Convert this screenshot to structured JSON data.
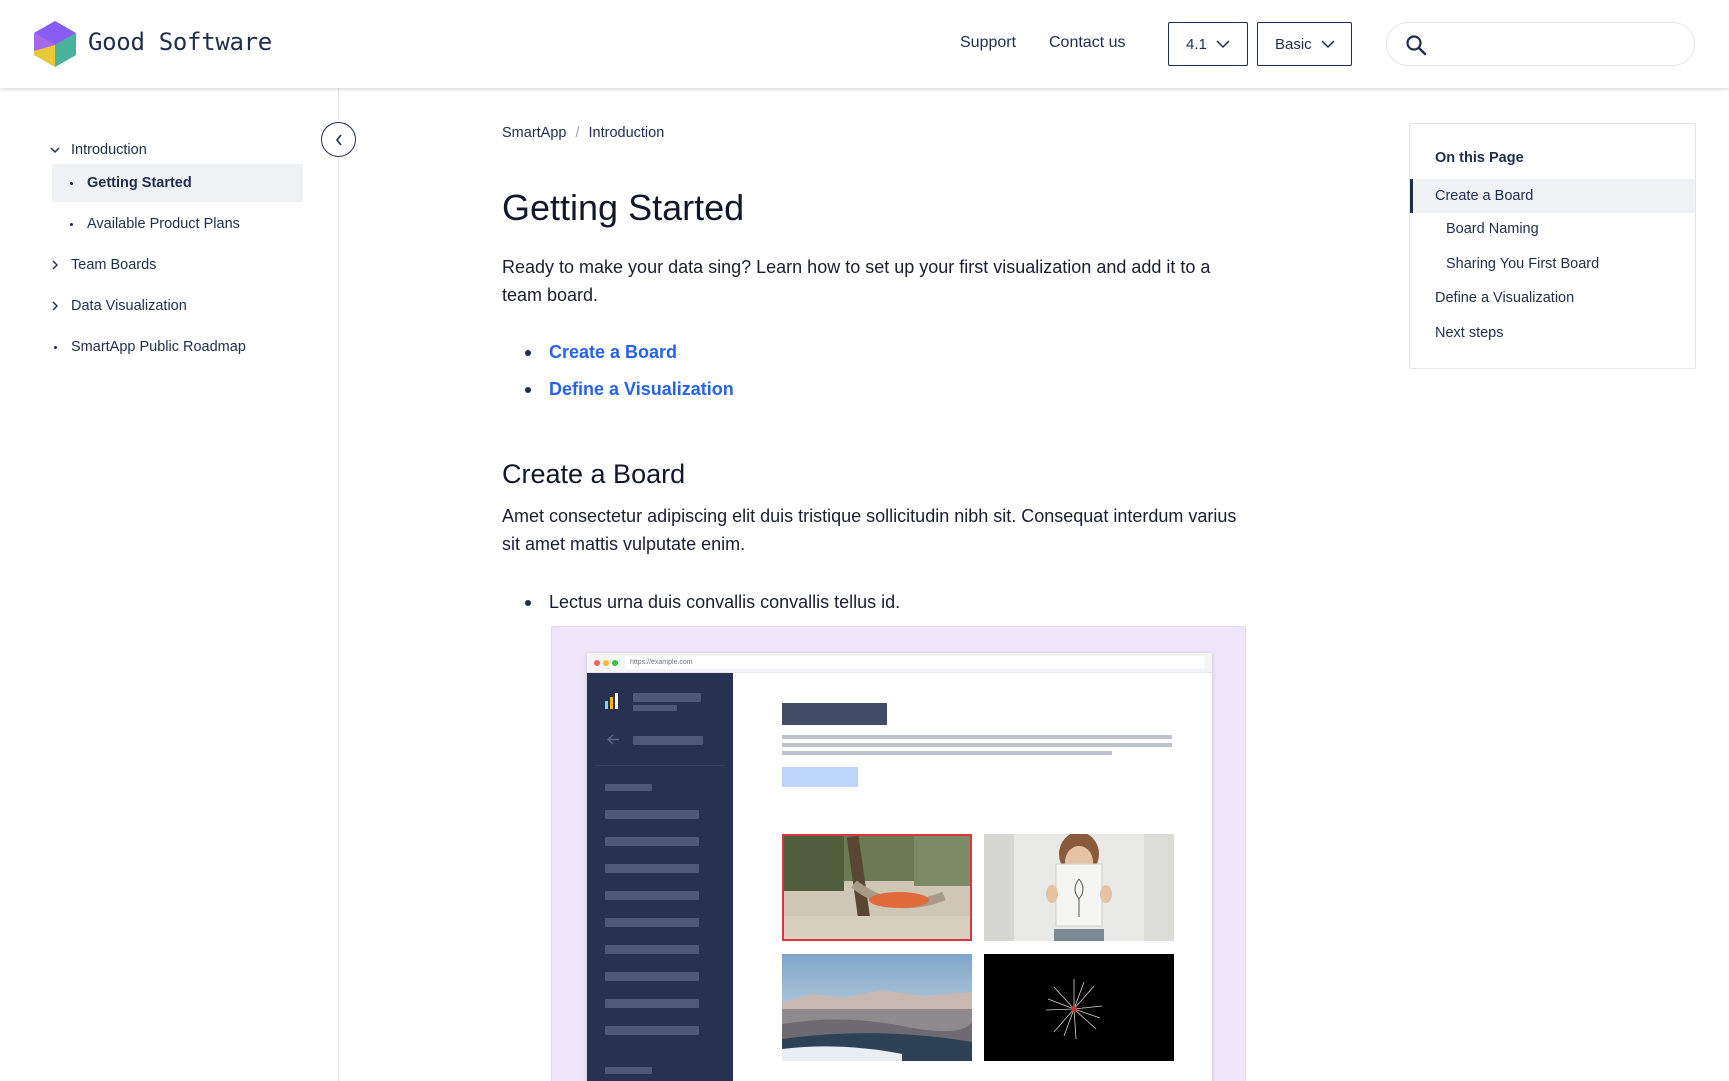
{
  "header": {
    "brand": "Good Software",
    "nav": [
      {
        "label": "Support"
      },
      {
        "label": "Contact us"
      }
    ],
    "version_select": "4.1",
    "plan_select": "Basic",
    "search": {
      "value": "",
      "placeholder": ""
    }
  },
  "sidebar": {
    "items": [
      {
        "label": "Introduction",
        "icon": "chevron-down-icon"
      },
      {
        "label": "Getting Started",
        "icon": "dot",
        "active": true
      },
      {
        "label": "Available Product Plans",
        "icon": "dot"
      },
      {
        "label": "Team Boards",
        "icon": "chevron-right-icon"
      },
      {
        "label": "Data Visualization",
        "icon": "chevron-right-icon"
      },
      {
        "label": "SmartApp Public Roadmap",
        "icon": "dot"
      }
    ],
    "collapse_icon": "chevron-left-icon"
  },
  "breadcrumb": {
    "items": [
      "SmartApp",
      "Introduction"
    ],
    "separator": "/"
  },
  "main": {
    "title": "Getting Started",
    "intro": "Ready to make your data sing? Learn how to set up your first visualization and add it to a team board.",
    "links": [
      "Create a Board",
      "Define a Visualization"
    ],
    "section_title": "Create a Board",
    "section_text": "Amet consectetur adipiscing elit duis tristique sollicitudin nibh sit. Consequat interdum varius sit amet mattis vulputate enim.",
    "section_bullet": "Lectus urna duis convallis convallis tellus id.",
    "illustration": {
      "url": "https://example.com"
    }
  },
  "toc": {
    "heading": "On this Page",
    "items": [
      {
        "label": "Create a Board",
        "active": true
      },
      {
        "label": "Board Naming"
      },
      {
        "label": "Sharing You First Board"
      },
      {
        "label": "Define a Visualization"
      },
      {
        "label": "Next steps"
      }
    ]
  },
  "colors": {
    "navy": "#1f2d4d",
    "link": "#2563eb",
    "illustration_bg": "#efe6f9",
    "mock_sidebar": "#263250",
    "active_bg": "#f0f1f5"
  }
}
